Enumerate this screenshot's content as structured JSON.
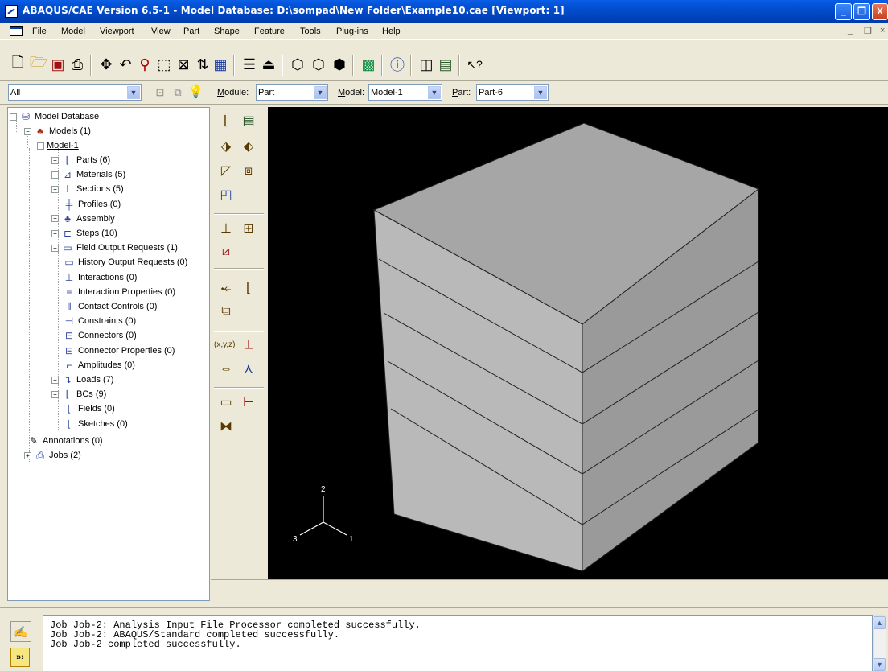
{
  "window": {
    "title": "ABAQUS/CAE Version 6.5-1 - Model Database: D:\\sompad\\New Folder\\Example10.cae [Viewport: 1]",
    "minimize": "_",
    "restore": "❐",
    "close": "X",
    "mdi_controls": [
      "_",
      "❐",
      "×"
    ]
  },
  "menu": [
    "File",
    "Model",
    "Viewport",
    "View",
    "Part",
    "Shape",
    "Feature",
    "Tools",
    "Plug-ins",
    "Help"
  ],
  "toolbar_icons": [
    "new-file",
    "open-file",
    "save",
    "print",
    "pan",
    "rotate",
    "magnify",
    "box-zoom",
    "auto-fit",
    "cycle-views",
    "table",
    "render-style",
    "hidden-lines",
    "wireframe-iso",
    "hidden-iso",
    "shaded-iso",
    "mesh-cube",
    "info",
    "viewport-layout",
    "viewport-window",
    "query"
  ],
  "context": {
    "filter_value": "All",
    "module_label": "Module:",
    "module_value": "Part",
    "model_label": "Model:",
    "model_value": "Model-1",
    "part_label": "Part:",
    "part_value": "Part-6"
  },
  "tree": {
    "root": "Model Database",
    "models": "Models (1)",
    "model": "Model-1",
    "children": [
      {
        "label": "Parts (6)",
        "expandable": true,
        "icon": "part-icon"
      },
      {
        "label": "Materials (5)",
        "expandable": true,
        "icon": "material-icon"
      },
      {
        "label": "Sections (5)",
        "expandable": true,
        "icon": "section-icon"
      },
      {
        "label": "Profiles (0)",
        "expandable": false,
        "icon": "profile-icon"
      },
      {
        "label": "Assembly",
        "expandable": true,
        "icon": "assembly-icon"
      },
      {
        "label": "Steps (10)",
        "expandable": true,
        "icon": "step-icon"
      },
      {
        "label": "Field Output Requests (1)",
        "expandable": true,
        "icon": "field-output-icon"
      },
      {
        "label": "History Output Requests (0)",
        "expandable": false,
        "icon": "history-output-icon"
      },
      {
        "label": "Interactions (0)",
        "expandable": false,
        "icon": "interaction-icon"
      },
      {
        "label": "Interaction Properties (0)",
        "expandable": false,
        "icon": "interaction-property-icon"
      },
      {
        "label": "Contact Controls (0)",
        "expandable": false,
        "icon": "contact-control-icon"
      },
      {
        "label": "Constraints (0)",
        "expandable": false,
        "icon": "constraint-icon"
      },
      {
        "label": "Connectors (0)",
        "expandable": false,
        "icon": "connector-icon"
      },
      {
        "label": "Connector Properties (0)",
        "expandable": false,
        "icon": "connector-property-icon"
      },
      {
        "label": "Amplitudes (0)",
        "expandable": false,
        "icon": "amplitude-icon"
      },
      {
        "label": "Loads (7)",
        "expandable": true,
        "icon": "load-icon"
      },
      {
        "label": "BCs (9)",
        "expandable": true,
        "icon": "bc-icon"
      },
      {
        "label": "Fields (0)",
        "expandable": false,
        "icon": "field-icon"
      },
      {
        "label": "Sketches (0)",
        "expandable": false,
        "icon": "sketch-icon"
      }
    ],
    "annotations": "Annotations (0)",
    "jobs": "Jobs (2)"
  },
  "triad": {
    "axis_y": "2",
    "axis_x": "1",
    "axis_z": "3"
  },
  "messages": [
    "Job Job-2: Analysis Input File Processor completed successfully.",
    "Job Job-2: ABAQUS/Standard completed successfully.",
    "Job Job-2 completed successfully."
  ],
  "message_toggle_label": "»›",
  "colors": {
    "viewport_bg": "#000000",
    "part_top": "#a6a6a6",
    "part_left": "#b9b9b9",
    "part_right": "#999999"
  }
}
